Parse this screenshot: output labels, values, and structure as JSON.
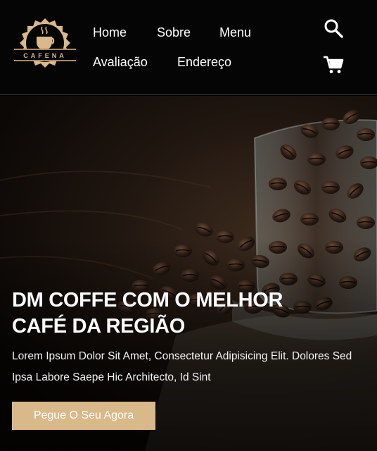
{
  "brand": {
    "logo_text": "CAFENA",
    "accent": "#d9b88a"
  },
  "nav": {
    "items": [
      "Home",
      "Sobre",
      "Menu",
      "Avaliação",
      "Endereço"
    ]
  },
  "icons": {
    "search": "search-icon",
    "cart": "cart-icon"
  },
  "hero": {
    "title": "DM COFFE COM O MELHOR CAFÉ DA REGIÃO",
    "text": "Lorem Ipsum Dolor Sit Amet, Consectetur Adipisicing Elit. Dolores Sed Ipsa Labore Saepe Hic Architecto, Id Sint",
    "cta_label": "Pegue O Seu Agora"
  }
}
